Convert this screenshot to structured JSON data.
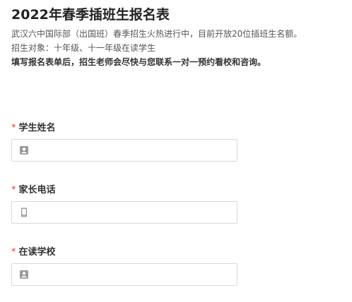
{
  "header": {
    "title": "2022年春季插班生报名表",
    "line1": "武汉六中国际部（出国班）春季招生火热进行中，目前开放20位插班生名额。",
    "line2": "招生对象：十年级、十一年级在读学生",
    "line3": "填写报名表单后，招生老师会尽快与您联系一对一预约看校和咨询。"
  },
  "fields": [
    {
      "required_mark": "*",
      "label": "学生姓名",
      "value": "",
      "placeholder": "",
      "icon": "person-card-icon"
    },
    {
      "required_mark": "*",
      "label": "家长电话",
      "value": "",
      "placeholder": "",
      "icon": "phone-icon"
    },
    {
      "required_mark": "*",
      "label": "在读学校",
      "value": "",
      "placeholder": "",
      "icon": "person-card-icon"
    }
  ],
  "colors": {
    "required": "#e03c3c",
    "icon": "#9a9a9a",
    "border": "#d9d9d9"
  }
}
